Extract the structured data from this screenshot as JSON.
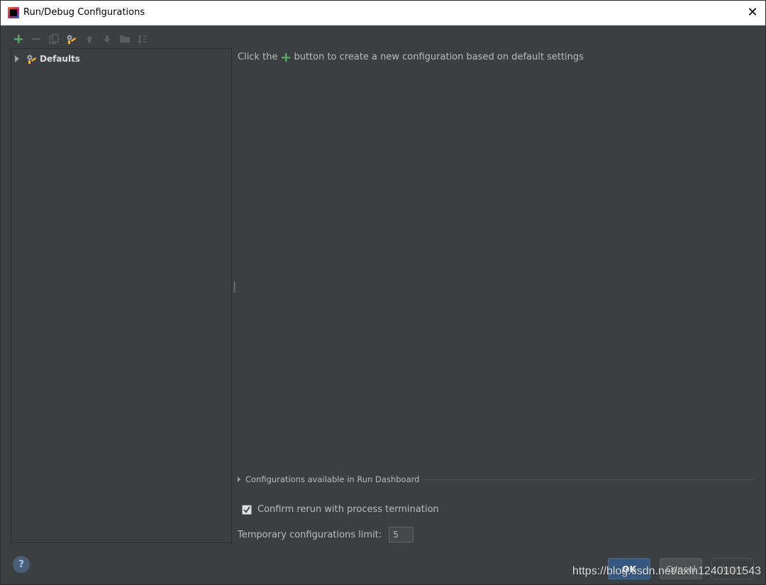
{
  "window": {
    "title": "Run/Debug Configurations"
  },
  "toolbar": {
    "icons": [
      "add-icon",
      "remove-icon",
      "copy-icon",
      "edit-defaults-icon",
      "move-up-icon",
      "move-down-icon",
      "folder-icon",
      "sort-icon"
    ]
  },
  "tree": {
    "items": [
      {
        "label": "Defaults",
        "expanded": false,
        "icon": "wrench-gear-icon"
      }
    ]
  },
  "content": {
    "hint_before": "Click the",
    "hint_after": "button to create a new configuration based on default settings",
    "dashboard_label": "Configurations available in Run Dashboard",
    "confirm_label": "Confirm rerun with process termination",
    "confirm_checked": true,
    "limit_label": "Temporary configurations limit:",
    "limit_value": "5"
  },
  "buttons": {
    "help": "?",
    "ok": "OK",
    "cancel": "Cancel",
    "apply": "Apply"
  },
  "watermark": "https://blog.csdn.net/axin1240101543",
  "colors": {
    "background": "#3c3f41",
    "accent_green": "#59a869",
    "ok_button": "#365880"
  }
}
